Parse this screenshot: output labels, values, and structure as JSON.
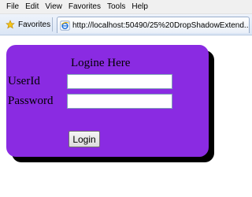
{
  "menubar": {
    "items": [
      "File",
      "Edit",
      "View",
      "Favorites",
      "Tools",
      "Help"
    ]
  },
  "favorites_bar": {
    "favorites_label": "Favorites",
    "tab_url": "http://localhost:50490/25%20DropShadowExtend..."
  },
  "login": {
    "title": "Logine Here",
    "userid_label": "UserId",
    "password_label": "Password",
    "userid_value": "",
    "password_value": "",
    "button_label": "Login"
  },
  "colors": {
    "panel_background": "#8a2be2",
    "panel_shadow": "#000000"
  }
}
